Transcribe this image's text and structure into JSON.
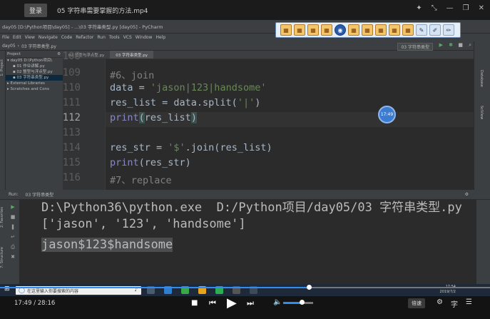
{
  "player": {
    "login": "登录",
    "video_title": "05 字符串需要掌握的方法.mp4",
    "time": "17:49 / 28:16",
    "progress": 0.63,
    "volume": 0.62,
    "speed": "倍速",
    "subtitle_icon": "字",
    "top_icons": [
      "pin-icon",
      "fullscreen-exit-icon",
      "minimize-icon",
      "restore-icon",
      "close-icon"
    ]
  },
  "pycharm": {
    "window_title": "day05 [D:\\Python项目\\day05] - ...\\03 字符串类型.py [day05] - PyCharm",
    "menu": [
      "File",
      "Edit",
      "View",
      "Navigate",
      "Code",
      "Refactor",
      "Run",
      "Tools",
      "VCS",
      "Window",
      "Help"
    ],
    "breadcrumb": [
      "day05",
      "03 字符串类型.py"
    ],
    "run_config": "03 字符串类型",
    "project_panel": {
      "title": "Project",
      "items": [
        "day05  D:\\Python项目\\",
        "01 作业讲解.py",
        "02 整型与浮点型.py",
        "03 字符串类型.py",
        "External Libraries",
        "Scratches and Cons"
      ]
    },
    "tabs": [
      "02 整型与浮点型.py",
      "03 字符串类型.py"
    ],
    "editor": {
      "lines": [
        {
          "no": "109",
          "text": "#6、join"
        },
        {
          "no": "110",
          "text": "data = 'jason|123|handsome'"
        },
        {
          "no": "111",
          "text": "res_list = data.split('|')"
        },
        {
          "no": "112",
          "text": "print(res_list)"
        },
        {
          "no": "113",
          "text": ""
        },
        {
          "no": "114",
          "text": "res_str = '$'.join(res_list)"
        },
        {
          "no": "115",
          "text": "print(res_str)"
        },
        {
          "no": "116",
          "text": "#7、replace"
        }
      ]
    },
    "badge_time": "17:49",
    "run_panel": {
      "label": "Run:",
      "tab": "03 字符串类型",
      "output": [
        "D:\\Python36\\python.exe  D:/Python项目/day05/03 字符串类型.py",
        "['jason', '123', 'handsome']",
        "jason$123$handsome"
      ]
    },
    "side_labels": {
      "project": "1: Project",
      "structure": "7: Structure",
      "favorites": "2: Favorites",
      "database": "Database",
      "sciview": "SciView"
    }
  },
  "taskbar": {
    "search_placeholder": "在这里输入你要搜索的内容",
    "clock_time": "17:54",
    "clock_date": "2019/7/2"
  }
}
